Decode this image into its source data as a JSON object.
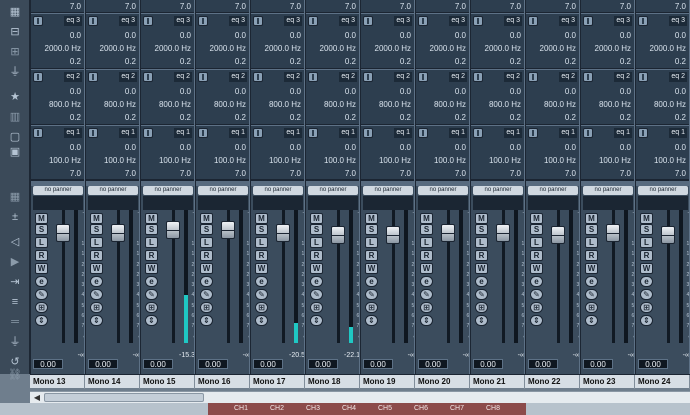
{
  "toolbar": {
    "icons": [
      "mixer-icon",
      "inserts-icon",
      "sends-icon",
      "plug-icon",
      "star-icon",
      "meter-icon",
      "frame-icon",
      "window-icon",
      "grid-icon",
      "expand-icon",
      "arrow-icon",
      "play-icon",
      "shift-icon",
      "list-icon",
      "equal-icon",
      "plug2-icon",
      "rotate-icon",
      "link-icon"
    ]
  },
  "eq_bands": [
    {
      "label": "eq 3",
      "freq": "2000.0 Hz",
      "gain": "0.0",
      "q": "0.2"
    },
    {
      "label": "eq 2",
      "freq": "800.0 Hz",
      "gain": "0.0",
      "q": "0.2"
    },
    {
      "label": "eq 1",
      "freq": "100.0 Hz",
      "gain": "0.0",
      "q": "7.0"
    }
  ],
  "top_value": "7.0",
  "panner_label": "no panner",
  "buttons": [
    "M",
    "S",
    "L",
    "R",
    "W",
    "e",
    "✎",
    "⊞",
    "⇕"
  ],
  "meter_scale": [
    "-5",
    "0",
    "5",
    "10",
    "15",
    "20",
    "24",
    "30",
    "40",
    "50",
    "60",
    "70",
    "∞"
  ],
  "channels": [
    {
      "name": "Mono 13",
      "volume": "0.00",
      "peak": "-∞",
      "level": 0
    },
    {
      "name": "Mono 14",
      "volume": "0.00",
      "peak": "-∞",
      "level": 0
    },
    {
      "name": "Mono 15",
      "volume": "0.00",
      "peak": "-15.3",
      "level": 0.36
    },
    {
      "name": "Mono 16",
      "volume": "0.00",
      "peak": "-∞",
      "level": 0
    },
    {
      "name": "Mono 17",
      "volume": "0.00",
      "peak": "-20.5",
      "level": 0.15
    },
    {
      "name": "Mono 18",
      "volume": "0.00",
      "peak": "-22.1",
      "level": 0.12
    },
    {
      "name": "Mono 19",
      "volume": "0.00",
      "peak": "-∞",
      "level": 0
    },
    {
      "name": "Mono 20",
      "volume": "0.00",
      "peak": "-∞",
      "level": 0
    },
    {
      "name": "Mono 21",
      "volume": "0.00",
      "peak": "-∞",
      "level": 0
    },
    {
      "name": "Mono 22",
      "volume": "0.00",
      "peak": "-∞",
      "level": 0
    },
    {
      "name": "Mono 23",
      "volume": "0.00",
      "peak": "-∞",
      "level": 0
    },
    {
      "name": "Mono 24",
      "volume": "0.00",
      "peak": "-∞",
      "level": 0
    }
  ],
  "bottom_bar": {
    "channels": [
      "CH1",
      "CH2",
      "CH3",
      "CH4",
      "CH5",
      "CH6",
      "CH7",
      "CH8"
    ]
  },
  "colors": {
    "meter": "#1fc8c4",
    "strip_bg": "#3b4c5d",
    "display": "#2d3e4f"
  }
}
